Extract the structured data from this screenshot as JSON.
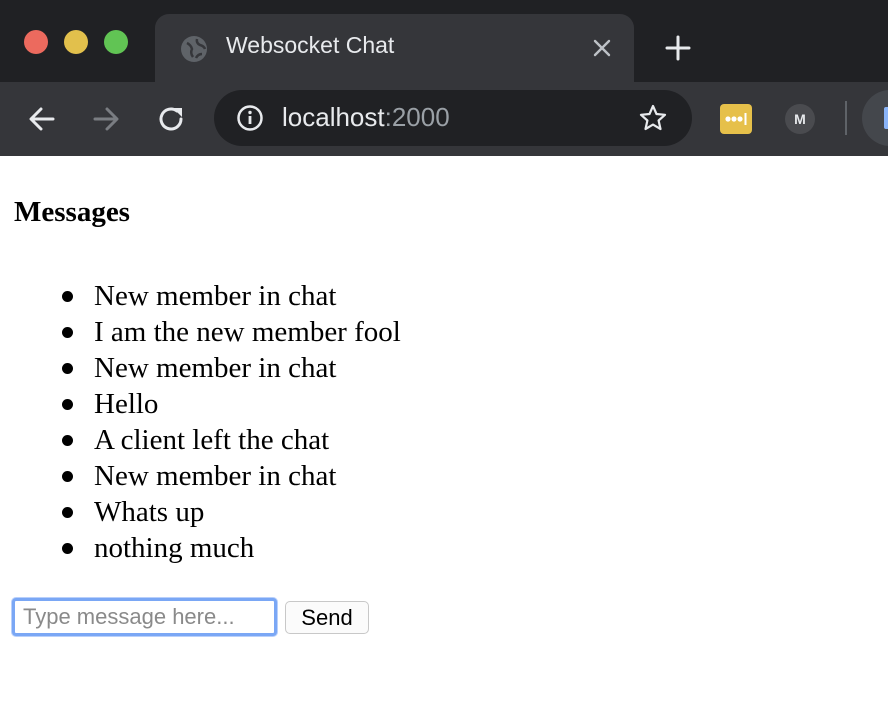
{
  "browser": {
    "tab_title": "Websocket Chat",
    "url_host": "localhost",
    "url_port": ":2000",
    "extension_m_label": "M",
    "icons": {
      "tab_favicon": "globe-icon",
      "tab_close": "close-icon",
      "new_tab": "plus-icon",
      "back": "back-arrow-icon",
      "forward": "forward-arrow-icon",
      "reload": "reload-icon",
      "site_info": "info-icon",
      "bookmark": "star-icon",
      "extension_lastpass": "lastpass-icon"
    },
    "colors": {
      "close": "#ec6a5e",
      "minimize": "#e2c04c",
      "zoom": "#61c454",
      "focus_ring": "#7aa7f5"
    }
  },
  "page": {
    "heading": "Messages",
    "messages": [
      "New member in chat",
      "I am the new member fool",
      "New member in chat",
      "Hello",
      "A client left the chat",
      "New member in chat",
      "Whats up",
      "nothing much"
    ],
    "input": {
      "placeholder": "Type message here...",
      "value": ""
    },
    "send_label": "Send"
  }
}
